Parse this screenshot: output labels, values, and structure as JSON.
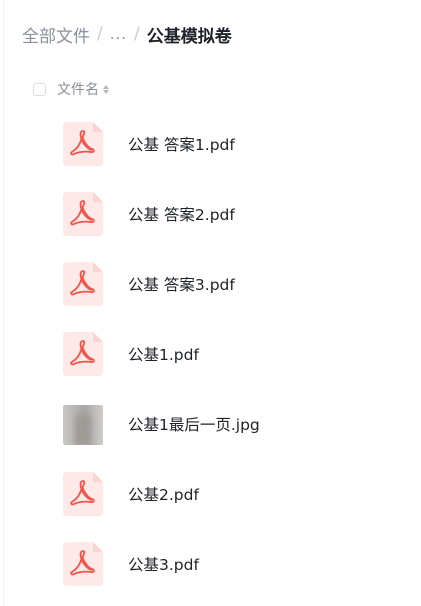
{
  "breadcrumb": {
    "root": "全部文件",
    "separator": "/",
    "ellipsis": "...",
    "current": "公基模拟卷"
  },
  "list_header": {
    "name_column": "文件名",
    "sort_icon": "sort-updown-icon"
  },
  "colors": {
    "pdf_icon_bg": "#fde9e7",
    "pdf_icon_fold": "#fbd3cf",
    "pdf_glyph": "#f0554b",
    "text_primary": "#1f2329",
    "text_secondary": "#8a8f99"
  },
  "files": [
    {
      "name": "公基 答案1.pdf",
      "type": "pdf",
      "icon": "pdf-file-icon"
    },
    {
      "name": "公基 答案2.pdf",
      "type": "pdf",
      "icon": "pdf-file-icon"
    },
    {
      "name": "公基 答案3.pdf",
      "type": "pdf",
      "icon": "pdf-file-icon"
    },
    {
      "name": "公基1.pdf",
      "type": "pdf",
      "icon": "pdf-file-icon"
    },
    {
      "name": "公基1最后一页.jpg",
      "type": "jpg",
      "icon": "image-thumbnail"
    },
    {
      "name": "公基2.pdf",
      "type": "pdf",
      "icon": "pdf-file-icon"
    },
    {
      "name": "公基3.pdf",
      "type": "pdf",
      "icon": "pdf-file-icon"
    }
  ]
}
